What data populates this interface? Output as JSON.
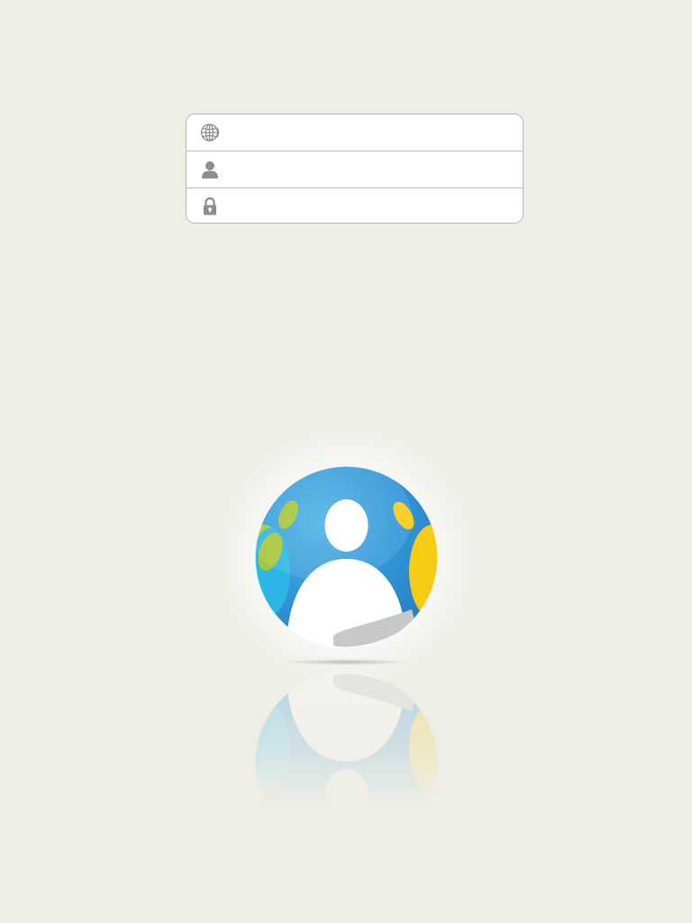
{
  "login_form": {
    "server_field": {
      "icon": "globe-icon",
      "value": "",
      "placeholder": ""
    },
    "username_field": {
      "icon": "user-icon",
      "value": "",
      "placeholder": ""
    },
    "password_field": {
      "icon": "lock-icon",
      "value": "",
      "placeholder": ""
    }
  },
  "colors": {
    "background": "#eeede6",
    "field_icon": "#8e8e8e",
    "logo_blue": "#2f95d6",
    "logo_light_blue": "#2bb6e6",
    "logo_green": "#a9c63a",
    "logo_yellow": "#f6cb14",
    "logo_gray": "#c8c8c8"
  },
  "logo": {
    "icon": "people-globe-logo"
  }
}
